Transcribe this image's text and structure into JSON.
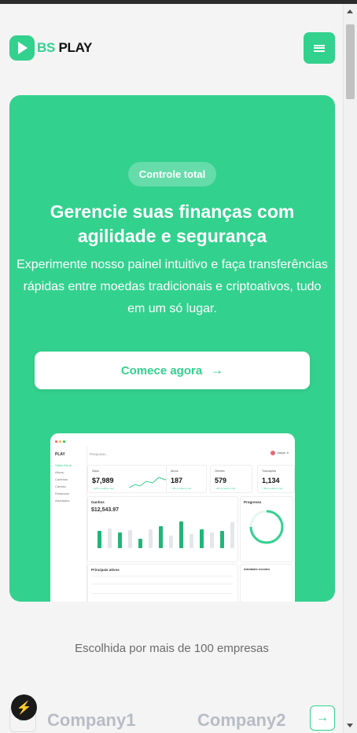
{
  "brand": {
    "part1": "BS",
    "part2": "PLAY"
  },
  "hero": {
    "badge": "Controle total",
    "title": "Gerencie suas finanças com agilidade e segurança",
    "subtitle": "Experimente nosso painel intuitivo e faça transferências rápidas entre moedas tradicionais e criptoativos, tudo em um só lugar.",
    "cta_label": "Comece agora",
    "cta_arrow": "→"
  },
  "dashboard": {
    "logo": "PLAY",
    "search": "Pesquisar...",
    "user": "Joseph Jr",
    "sidebar": [
      "Visão Geral",
      "Ativos",
      "Carteiras",
      "Câmbio",
      "Relatórios",
      "Atividades"
    ],
    "kpis": [
      {
        "label": "Saldo",
        "value": "$7,989",
        "sub": "↑ 12% no último mês"
      },
      {
        "label": "Ativos",
        "value": "187",
        "sub": "↑ 5% no último mês"
      },
      {
        "label": "Clientes",
        "value": "579",
        "sub": "↑ 8% no último mês"
      },
      {
        "label": "Transações",
        "value": "1,134",
        "sub": "↑ 3% no último mês"
      }
    ],
    "earnings": {
      "title": "Ganhos",
      "value": "$12,543.97",
      "bars": [
        0.55,
        0.62,
        0.5,
        0.58,
        0.3,
        0.6,
        0.7,
        0.4,
        0.85,
        0.45,
        0.6,
        0.5,
        0.55,
        0.82
      ]
    },
    "progress": {
      "title": "Progresso",
      "fraction": 0.75
    },
    "activities_title": "Atividades recentes",
    "table_title": "Principais ativos"
  },
  "companies": {
    "line": "Escolhida por mais de 100 empresas",
    "names": [
      "Company1",
      "Company2"
    ]
  },
  "colors": {
    "accent": "#33d18e",
    "background": "#f4f4f5"
  },
  "icons": [
    "menu-icon",
    "arrow-right-icon",
    "chevron-left-icon",
    "chevron-right-icon",
    "bolt-icon"
  ]
}
